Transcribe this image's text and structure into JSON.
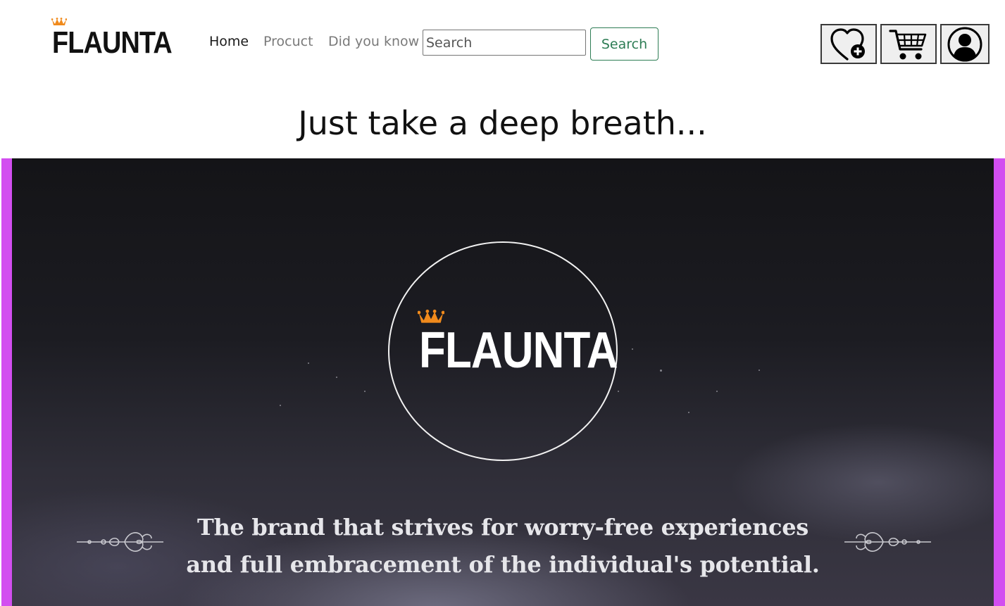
{
  "brand": {
    "name": "FLAUNTA",
    "crown_color": "#f08a1c"
  },
  "nav": {
    "links": [
      {
        "label": "Home",
        "active": true
      },
      {
        "label": "Procuct",
        "active": false
      },
      {
        "label": "Did you know",
        "active": false
      }
    ]
  },
  "search": {
    "placeholder": "Search",
    "button_label": "Search"
  },
  "header_icons": [
    "wishlist-heart-plus-icon",
    "shopping-cart-icon",
    "account-user-icon"
  ],
  "hero": {
    "heading": "Just take a deep breath...",
    "logo_text": "FLAUNTA",
    "tagline_line1": "The brand that strives for worry-free experiences",
    "tagline_line2": "and full embracement of the individual's potential.",
    "frame_color": "#d24ef0"
  }
}
